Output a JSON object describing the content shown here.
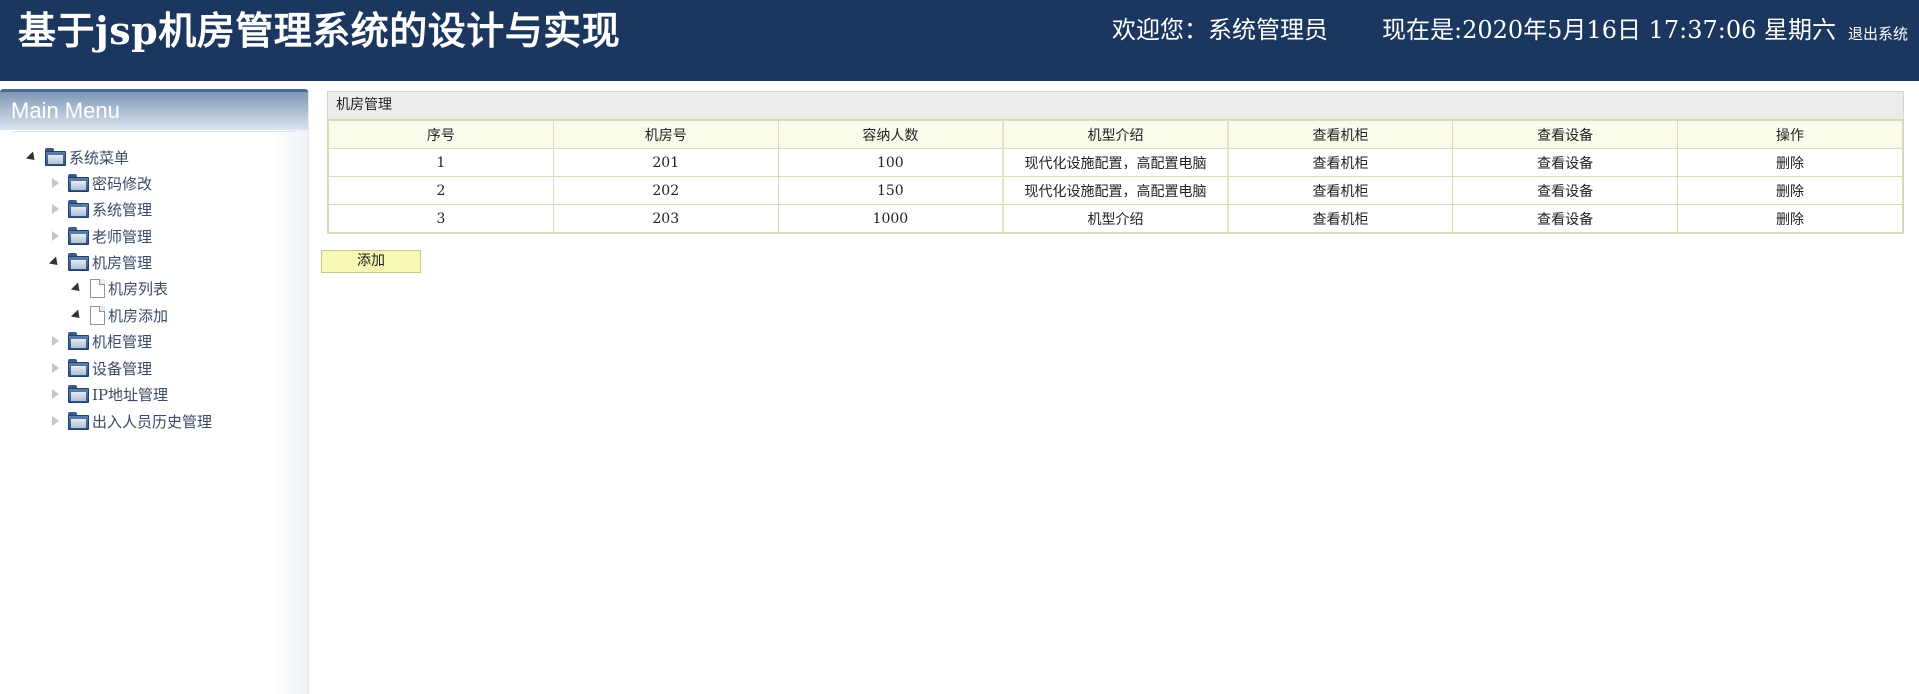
{
  "header": {
    "title": "基于jsp机房管理系统的设计与实现",
    "welcome": "欢迎您：系统管理员",
    "clock": "现在是:2020年5月16日 17:37:06 星期六",
    "logout": "退出系统"
  },
  "sidebar": {
    "menu_title": "Main Menu",
    "root": "系统菜单",
    "items": [
      {
        "label": "密码修改",
        "icon": "folder-icon",
        "expanded": false
      },
      {
        "label": "系统管理",
        "icon": "folder-icon",
        "expanded": false
      },
      {
        "label": "老师管理",
        "icon": "folder-icon",
        "expanded": false
      },
      {
        "label": "机房管理",
        "icon": "folder-icon",
        "expanded": true,
        "children": [
          {
            "label": "机房列表",
            "icon": "document-icon"
          },
          {
            "label": "机房添加",
            "icon": "document-icon"
          }
        ]
      },
      {
        "label": "机柜管理",
        "icon": "folder-icon",
        "expanded": false
      },
      {
        "label": "设备管理",
        "icon": "folder-icon",
        "expanded": false
      },
      {
        "label": "IP地址管理",
        "icon": "folder-icon",
        "expanded": false
      },
      {
        "label": "出入人员历史管理",
        "icon": "folder-icon",
        "expanded": false
      }
    ]
  },
  "main": {
    "panel_title": "机房管理",
    "columns": [
      "序号",
      "机房号",
      "容纳人数",
      "机型介绍",
      "查看机柜",
      "查看设备",
      "操作"
    ],
    "rows": [
      [
        "1",
        "201",
        "100",
        "现代化设施配置，高配置电脑",
        "查看机柜",
        "查看设备",
        "删除"
      ],
      [
        "2",
        "202",
        "150",
        "现代化设施配置，高配置电脑",
        "查看机柜",
        "查看设备",
        "删除"
      ],
      [
        "3",
        "203",
        "1000",
        "机型介绍",
        "查看机柜",
        "查看设备",
        "删除"
      ]
    ],
    "add_label": "添加"
  },
  "colors": {
    "header_bg": "#1b365f",
    "table_header_bg": "#fbfbec",
    "add_button_bg": "#f6f8b4"
  }
}
